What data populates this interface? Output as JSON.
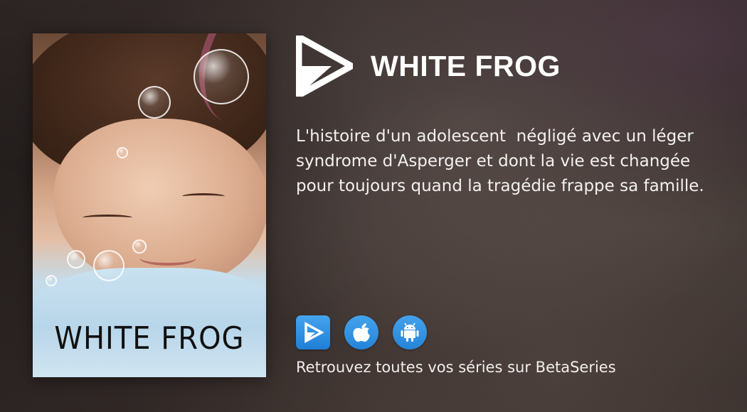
{
  "show": {
    "title": "WHITE FROG",
    "description": "L'histoire d'un adolescent  négligé avec un léger syndrome d'Asperger et dont la vie est changée pour toujours quand la tragédie frappe sa famille."
  },
  "poster": {
    "title_text": "WHITE FROG"
  },
  "apps": [
    {
      "name": "betaseries-web-icon"
    },
    {
      "name": "apple-icon"
    },
    {
      "name": "android-icon"
    }
  ],
  "footer": {
    "tagline": "Retrouvez toutes vos séries sur BetaSeries"
  },
  "colors": {
    "accent_blue": "#2a8ae0",
    "text": "#ffffff"
  }
}
